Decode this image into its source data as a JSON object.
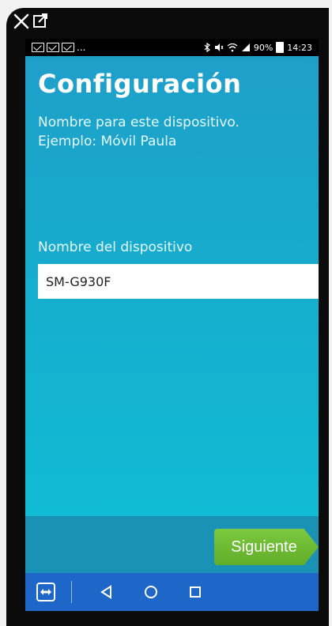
{
  "window": {
    "close_icon": "close-icon",
    "external_icon": "external-link-icon"
  },
  "status_bar": {
    "notifications": [
      "mail-icon",
      "mail-icon",
      "mail-icon"
    ],
    "ellipsis": "...",
    "icons": [
      "bluetooth-icon",
      "mute-icon",
      "wifi-icon",
      "signal-icon"
    ],
    "battery_percent": "90%",
    "time": "14:23"
  },
  "page": {
    "title": "Configuración",
    "description_line1": "Nombre para este dispositivo.",
    "description_line2": "Ejemplo: Móvil Paula"
  },
  "form": {
    "field_label": "Nombre del dispositivo",
    "field_value": "SM-G930F"
  },
  "actions": {
    "next_label": "Siguiente"
  },
  "nav": {
    "app_icon": "teamviewer-icon",
    "back_icon": "back-icon",
    "home_icon": "home-icon",
    "recents_icon": "recents-icon"
  },
  "colors": {
    "screen_top": "#1f9ec9",
    "screen_bottom": "#0fc1d7",
    "button_green": "#62ad2a",
    "nav_blue": "#1f66c9"
  }
}
